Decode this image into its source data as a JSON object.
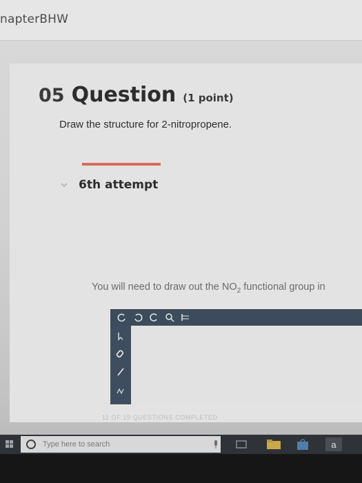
{
  "header": {
    "breadcrumb": "napterBHW"
  },
  "question": {
    "number": "05",
    "title": "Question",
    "points": "(1 point)",
    "prompt": "Draw the structure for 2-nitropropene."
  },
  "attempt": {
    "label": "6th attempt"
  },
  "hint": {
    "text_before": "You will need to draw out the NO",
    "subscript": "2",
    "text_after": " functional group in"
  },
  "editor": {
    "toolbar_icons": [
      "undo-icon",
      "redo-icon",
      "reset-icon",
      "zoom-icon",
      "template-icon"
    ],
    "side_icons": [
      "select-icon",
      "eraser-icon",
      "bond-icon",
      "atom-icon"
    ]
  },
  "status": {
    "progress": "11 OF 19 QUESTIONS COMPLETED"
  },
  "taskbar": {
    "search_placeholder": "Type here to search",
    "tray_letter": "a"
  },
  "colors": {
    "accent": "#d66b5a",
    "toolbar": "#3c4c5c",
    "taskbar": "#2f3236"
  }
}
